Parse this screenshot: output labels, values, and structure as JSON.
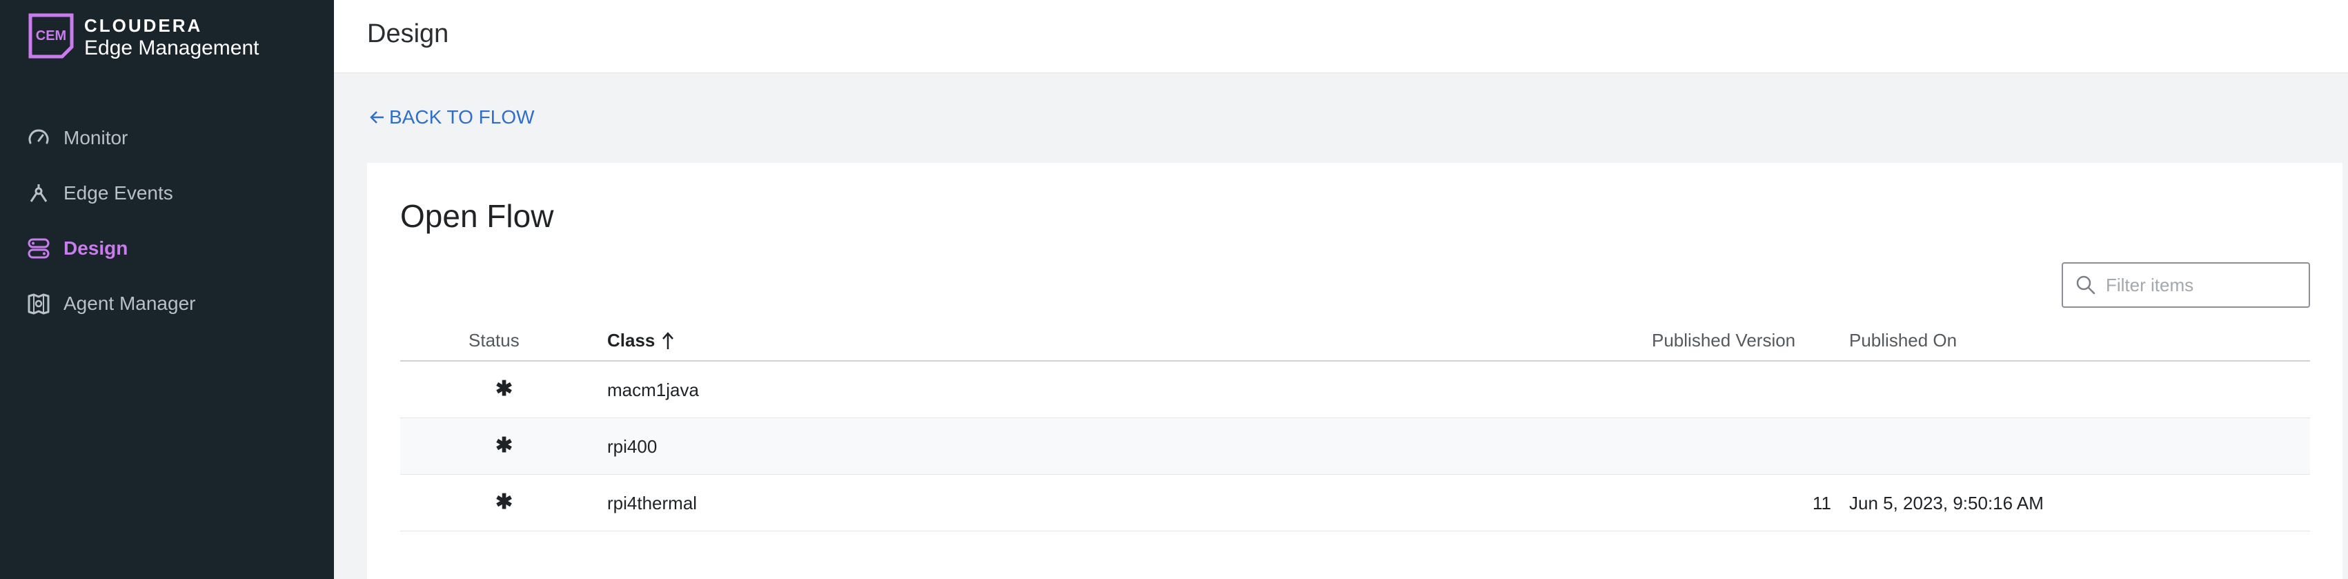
{
  "app": {
    "brand": "CLOUDERA",
    "product": "Edge Management",
    "logo_mark": "CEM"
  },
  "sidebar": {
    "items": [
      {
        "label": "Monitor",
        "icon": "gauge-icon",
        "active": false
      },
      {
        "label": "Edge Events",
        "icon": "event-nodes-icon",
        "active": false
      },
      {
        "label": "Design",
        "icon": "design-flow-icon",
        "active": true
      },
      {
        "label": "Agent Manager",
        "icon": "agent-manager-icon",
        "active": false
      }
    ]
  },
  "header": {
    "title": "Design"
  },
  "back_link": {
    "label": "BACK TO FLOW"
  },
  "card": {
    "title": "Open Flow",
    "filter_placeholder": "Filter items"
  },
  "table": {
    "columns": {
      "status": "Status",
      "class": "Class",
      "published_version": "Published Version",
      "published_on": "Published On"
    },
    "rows": [
      {
        "status": "✱",
        "class": "macm1java",
        "published_version": "",
        "published_on": ""
      },
      {
        "status": "✱",
        "class": "rpi400",
        "published_version": "",
        "published_on": ""
      },
      {
        "status": "✱",
        "class": "rpi4thermal",
        "published_version": "11",
        "published_on": "Jun 5, 2023, 9:50:16 AM"
      }
    ]
  },
  "colors": {
    "sidebar_bg": "#1a242b",
    "accent_purple": "#c97dec",
    "link_blue": "#2f6fc9"
  }
}
